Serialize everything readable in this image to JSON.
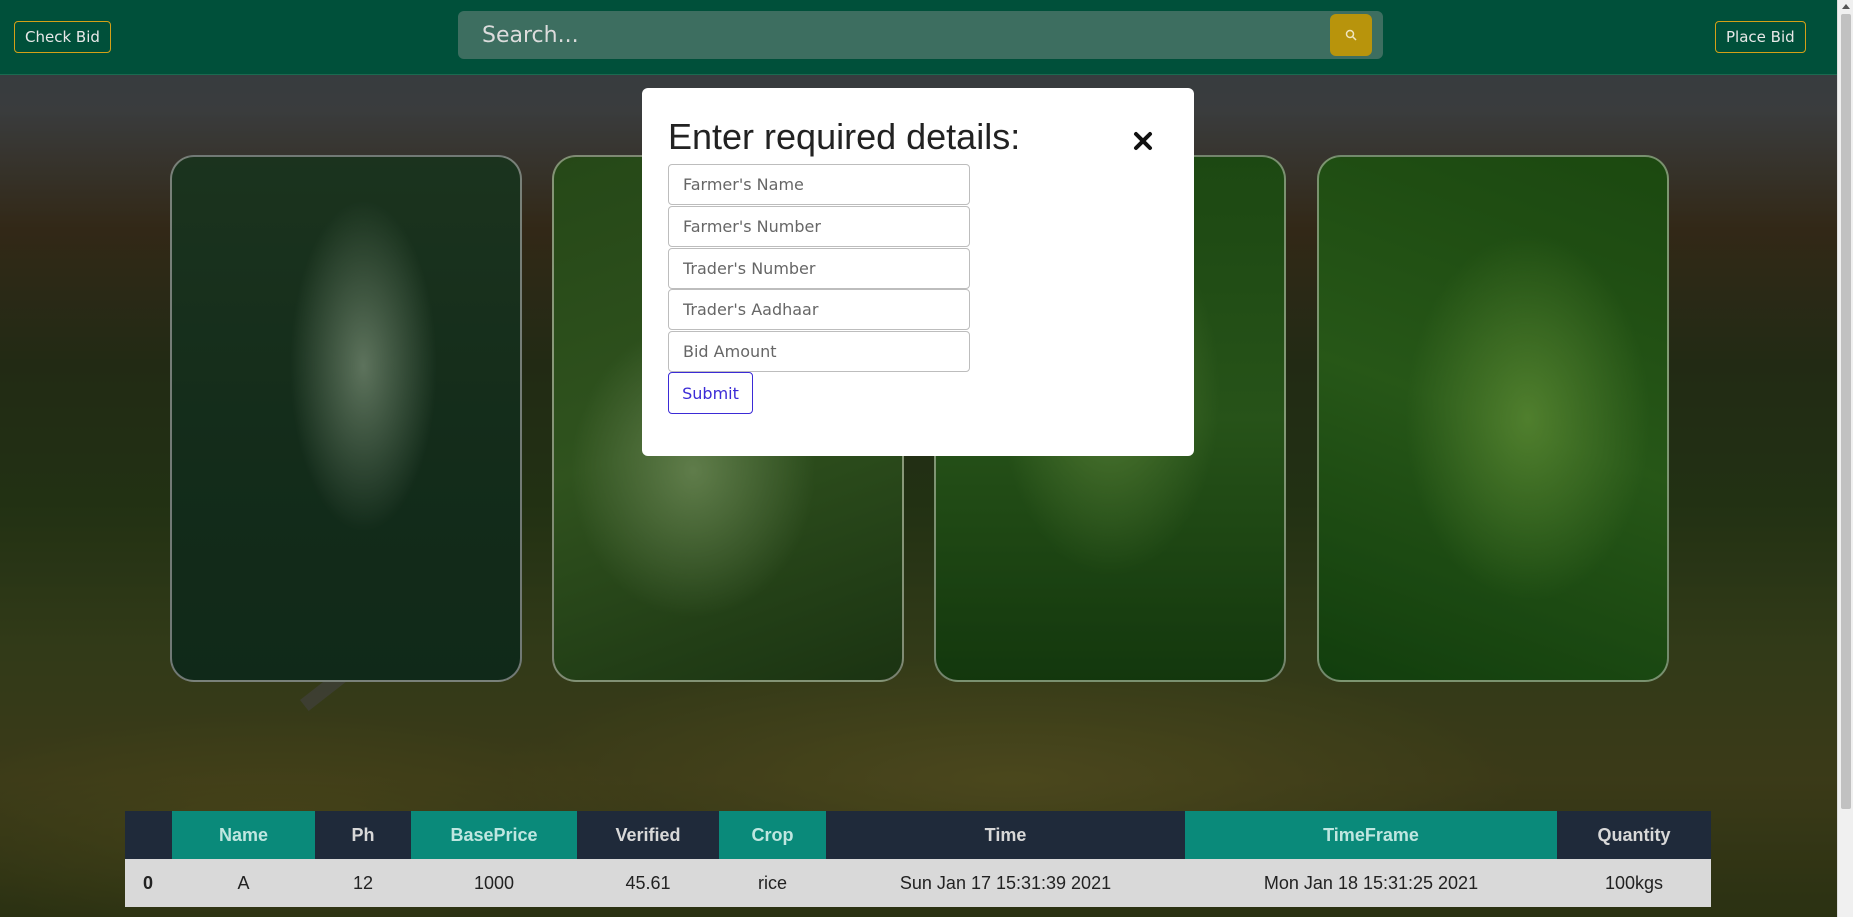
{
  "nav": {
    "check_bid_label": "Check Bid",
    "place_bid_label": "Place Bid",
    "search_placeholder": "Search..."
  },
  "cards": [
    {
      "name": "crop-image-1"
    },
    {
      "name": "crop-image-2"
    },
    {
      "name": "crop-image-3"
    },
    {
      "name": "crop-image-4"
    }
  ],
  "table": {
    "headers": [
      "",
      "Name",
      "Ph",
      "BasePrice",
      "Verified",
      "Crop",
      "Time",
      "TimeFrame",
      "Quantity"
    ],
    "rows": [
      [
        "0",
        "A",
        "12",
        "1000",
        "45.61",
        "rice",
        "Sun Jan 17 15:31:39 2021",
        "Mon Jan 18 15:31:25 2021",
        "100kgs"
      ]
    ]
  },
  "modal": {
    "title": "Enter required details:",
    "fields": {
      "farmer_name": "Farmer's Name",
      "farmer_number": "Farmer's Number",
      "trader_number": "Trader's Number",
      "trader_aadhaar": "Trader's Aadhaar",
      "bid_amount": "Bid Amount"
    },
    "submit_label": "Submit"
  },
  "colors": {
    "navbar": "#00503a",
    "accent_gold": "#b8940c",
    "table_header_dark": "#1f2a3a",
    "table_header_teal": "#0a8a7a",
    "submit_blue": "#3b2bd6"
  }
}
